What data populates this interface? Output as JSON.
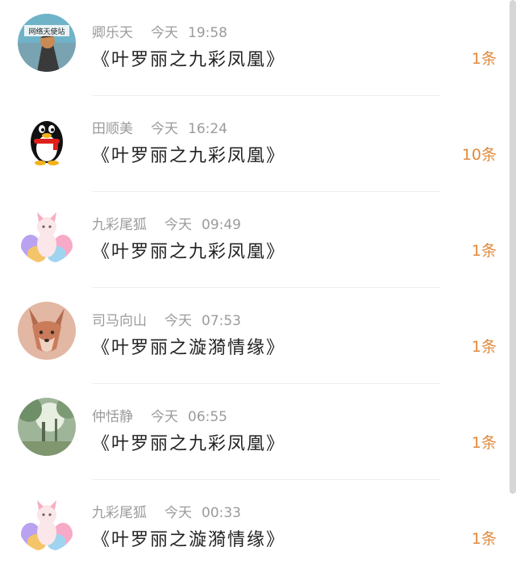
{
  "messages": [
    {
      "name": "卿乐天",
      "day": "今天",
      "time": "19:58",
      "title": "《叶罗丽之九彩凤凰》",
      "count": "1条",
      "avatar_label": "网络天使站",
      "avatar_icon": "character-avatar"
    },
    {
      "name": "田顺美",
      "day": "今天",
      "time": "16:24",
      "title": "《叶罗丽之九彩凤凰》",
      "count": "10条",
      "avatar_icon": "qq-penguin-avatar"
    },
    {
      "name": "九彩尾狐",
      "day": "今天",
      "time": "09:49",
      "title": "《叶罗丽之九彩凤凰》",
      "count": "1条",
      "avatar_icon": "nine-tailed-fox-avatar"
    },
    {
      "name": "司马向山",
      "day": "今天",
      "time": "07:53",
      "title": "《叶罗丽之漩漪情缘》",
      "count": "1条",
      "avatar_icon": "fox-sketch-avatar"
    },
    {
      "name": "仲恬静",
      "day": "今天",
      "time": "06:55",
      "title": "《叶罗丽之九彩凤凰》",
      "count": "1条",
      "avatar_icon": "forest-avatar"
    },
    {
      "name": "九彩尾狐",
      "day": "今天",
      "time": "00:33",
      "title": "《叶罗丽之漩漪情缘》",
      "count": "1条",
      "avatar_icon": "nine-tailed-fox-avatar"
    }
  ],
  "colors": {
    "meta_text": "#9b9b9b",
    "title_text": "#222222",
    "count_text": "#e08a3c",
    "divider": "#ededed"
  }
}
